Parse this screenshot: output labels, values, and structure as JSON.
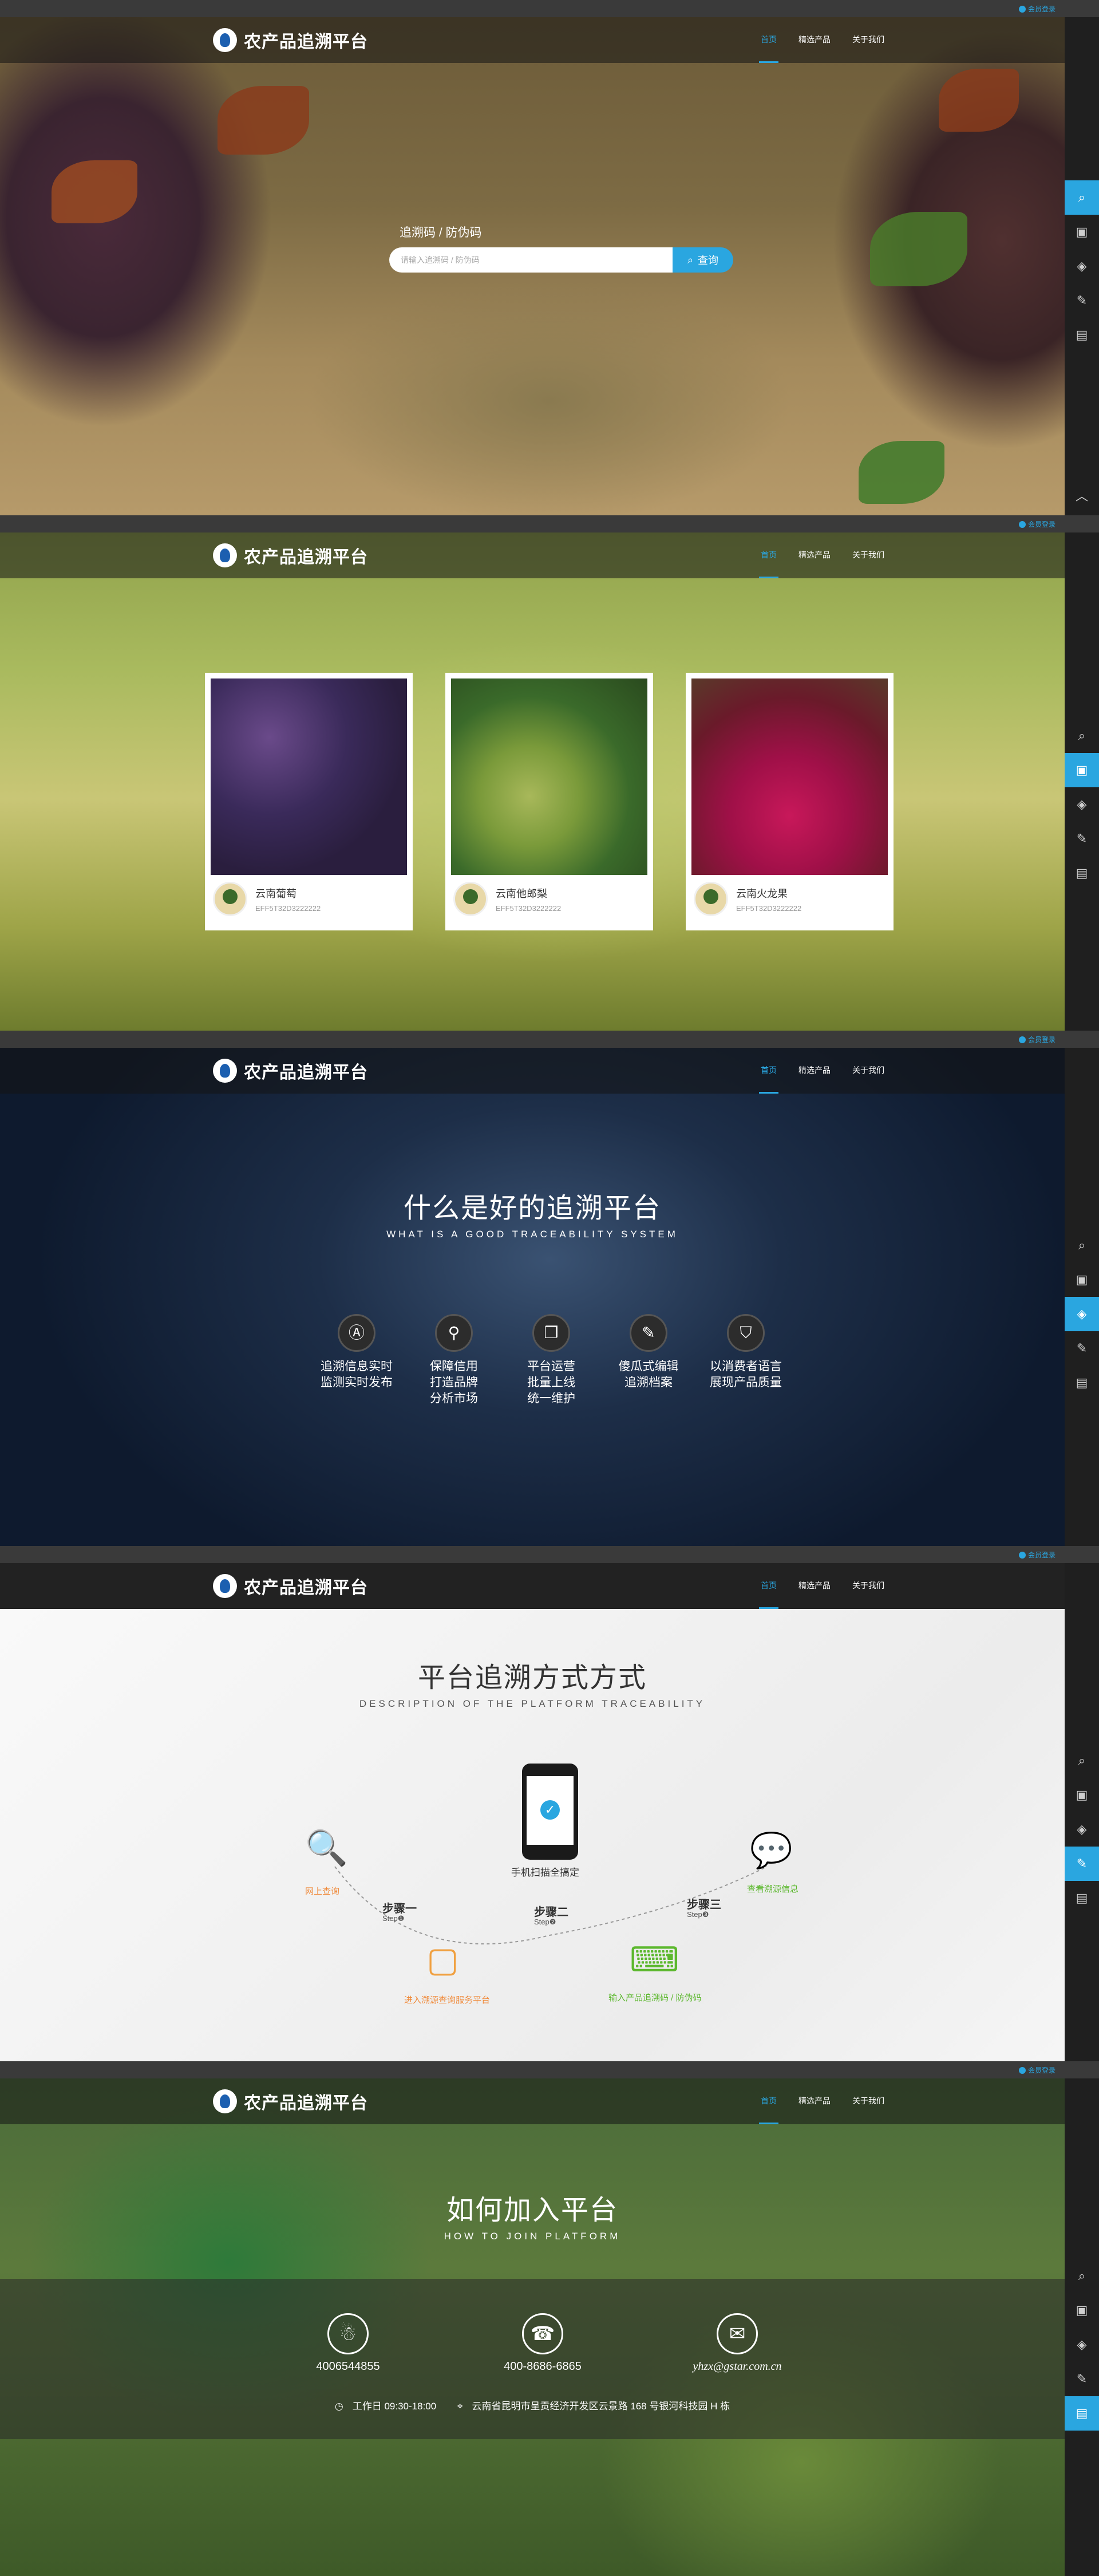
{
  "topbar": {
    "login": "会员登录"
  },
  "brand": {
    "name": "农产品追溯平台"
  },
  "nav": [
    {
      "label": "首页"
    },
    {
      "label": "精选产品"
    },
    {
      "label": "关于我们"
    }
  ],
  "search": {
    "label": "追溯码 / 防伪码",
    "placeholder": "请输入追溯码 / 防伪码",
    "button": "查询"
  },
  "products": [
    {
      "name": "云南葡萄",
      "code": "EFF5T32D3222222"
    },
    {
      "name": "云南他郎梨",
      "code": "EFF5T32D3222222"
    },
    {
      "name": "云南火龙果",
      "code": "EFF5T32D3222222"
    }
  ],
  "about": {
    "title": "什么是好的追溯平台",
    "subtitle": "WHAT IS A GOOD TRACEABILITY SYSTEM",
    "features": [
      {
        "lines": [
          "追溯信息实时",
          "监测实时发布"
        ]
      },
      {
        "lines": [
          "保障信用",
          "打造品牌",
          "分析市场"
        ]
      },
      {
        "lines": [
          "平台运营",
          "批量上线",
          "统一维护"
        ]
      },
      {
        "lines": [
          "傻瓜式编辑",
          "追溯档案"
        ]
      },
      {
        "lines": [
          "以消费者语言",
          "展现产品质量"
        ]
      }
    ]
  },
  "method": {
    "title": "平台追溯方式方式",
    "subtitle": "DESCRIPTION OF THE PLATFORM TRACEABILITY",
    "phone_label": "手机扫描全搞定",
    "node1": "网上查询",
    "node2": "进入溯源查询服务平台",
    "node3": "输入产品追溯码 / 防伪码",
    "node4": "查看溯源信息",
    "step1": "步骤一",
    "step2": "步骤二",
    "step3": "步骤三",
    "step1_en": "Step❶",
    "step2_en": "Step❷",
    "step3_en": "Step❸"
  },
  "join": {
    "title": "如何加入平台",
    "subtitle": "HOW TO JOIN PLATFORM",
    "qq": "4006544855",
    "phone": "400-8686-6865",
    "email": "yhzx@gstar.com.cn",
    "hours": "工作日 09:30-18:00",
    "address": "云南省昆明市呈贡经济开发区云景路 168 号银河科技园 H 栋"
  },
  "colors": {
    "accent": "#2aa6e0",
    "orange": "#f08a3a",
    "green": "#5cb82e"
  }
}
